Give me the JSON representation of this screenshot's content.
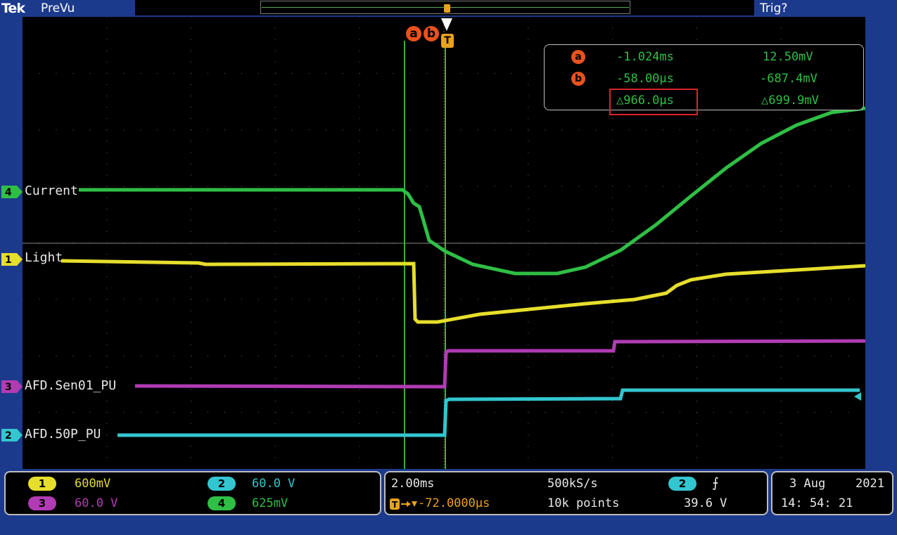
{
  "window": {
    "brand": "Tek",
    "mode": "PreVu",
    "trigger_status": "Trig?"
  },
  "colors": {
    "ch1": "#e6de2c",
    "ch2": "#33c6d0",
    "ch3": "#b13bb5",
    "ch4": "#2fbf45",
    "cursor": "#3fae3f",
    "badge": "#e8521d",
    "trigger": "#e8a21d",
    "highlight": "#d8242a"
  },
  "channels": [
    {
      "id": "4",
      "name": "Current"
    },
    {
      "id": "1",
      "name": "Light"
    },
    {
      "id": "3",
      "name": "AFD.Sen01_PU"
    },
    {
      "id": "2",
      "name": "AFD.50P_PU"
    }
  ],
  "cursors": {
    "labels": {
      "a": "a",
      "b": "b",
      "trigger": "T"
    },
    "a": {
      "time": "-1.024ms",
      "value": "12.50mV"
    },
    "b": {
      "time": "-58.00µs",
      "value": "-687.4mV"
    },
    "delta": {
      "time": "△966.0µs",
      "value": "△699.9mV"
    }
  },
  "status": {
    "vertical": [
      {
        "ch": "1",
        "scale": "600mV"
      },
      {
        "ch": "2",
        "scale": "60.0 V"
      },
      {
        "ch": "3",
        "scale": "60.0 V"
      },
      {
        "ch": "4",
        "scale": "625mV"
      }
    ],
    "horizontal": {
      "time_per_div": "2.00ms",
      "sample_rate": "500kS/s",
      "position": "-72.0000µs",
      "record_length": "10k points"
    },
    "trigger": {
      "source": "2",
      "slope": "rising-edge-icon",
      "slope_glyph": "⨍",
      "level": "39.6 V"
    },
    "date": "3 Aug",
    "year": "2021",
    "time": "14: 54: 21"
  }
}
